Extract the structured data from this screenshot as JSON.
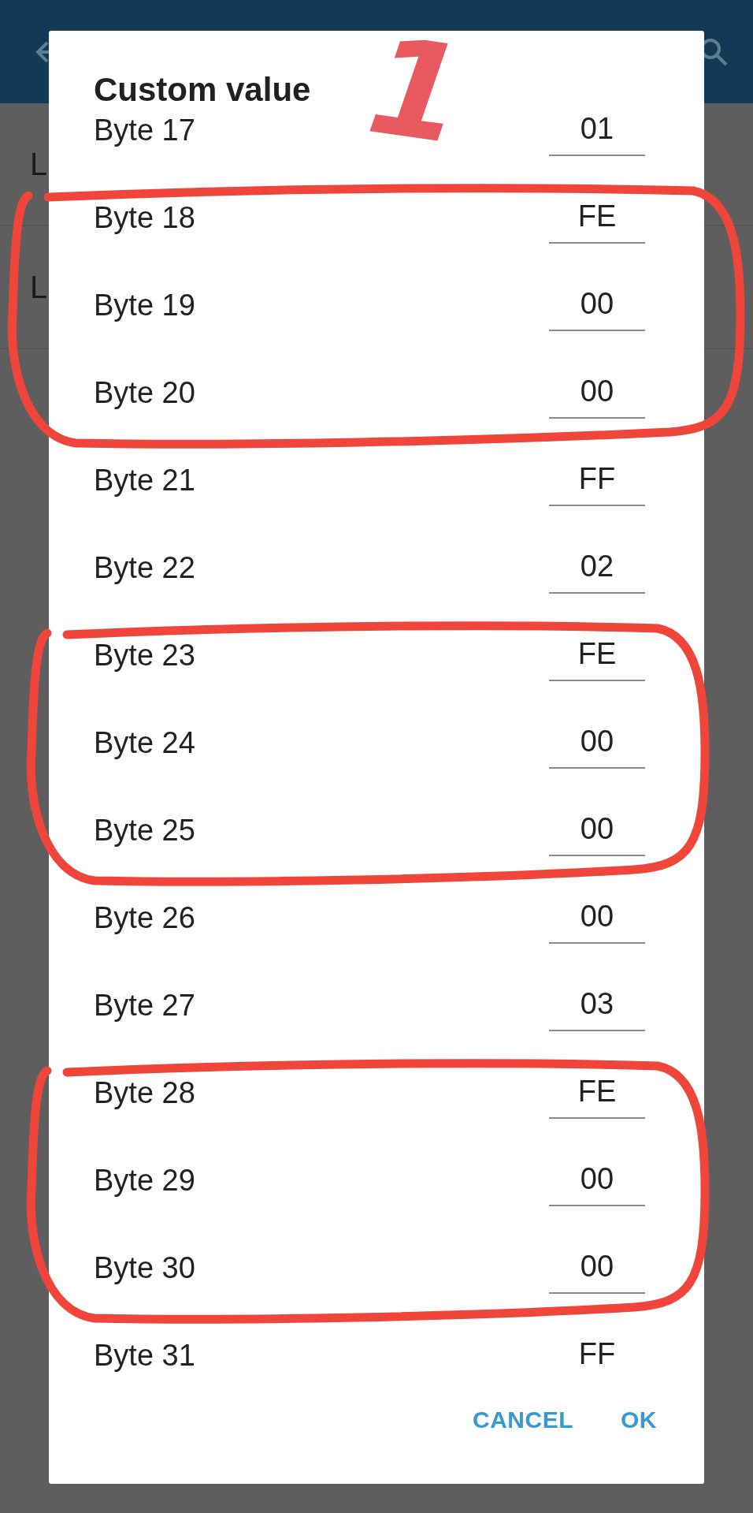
{
  "background_list": {
    "items": [
      "L",
      "L"
    ]
  },
  "dialog": {
    "title": "Custom value",
    "rows": [
      {
        "label": "Byte 17",
        "value": "01",
        "circled": false
      },
      {
        "label": "Byte 18",
        "value": "FE",
        "circled": true
      },
      {
        "label": "Byte 19",
        "value": "00",
        "circled": true
      },
      {
        "label": "Byte 20",
        "value": "00",
        "circled": true
      },
      {
        "label": "Byte 21",
        "value": "FF",
        "circled": false
      },
      {
        "label": "Byte 22",
        "value": "02",
        "circled": false
      },
      {
        "label": "Byte 23",
        "value": "FE",
        "circled": true
      },
      {
        "label": "Byte 24",
        "value": "00",
        "circled": true
      },
      {
        "label": "Byte 25",
        "value": "00",
        "circled": true
      },
      {
        "label": "Byte 26",
        "value": "00",
        "circled": false
      },
      {
        "label": "Byte 27",
        "value": "03",
        "circled": false
      },
      {
        "label": "Byte 28",
        "value": "FE",
        "circled": true
      },
      {
        "label": "Byte 29",
        "value": "00",
        "circled": true
      },
      {
        "label": "Byte 30",
        "value": "00",
        "circled": true
      },
      {
        "label": "Byte 31",
        "value": "FF",
        "circled": false
      }
    ],
    "buttons": [
      "CANCEL",
      "OK"
    ]
  },
  "annotation": {
    "label": "1"
  }
}
